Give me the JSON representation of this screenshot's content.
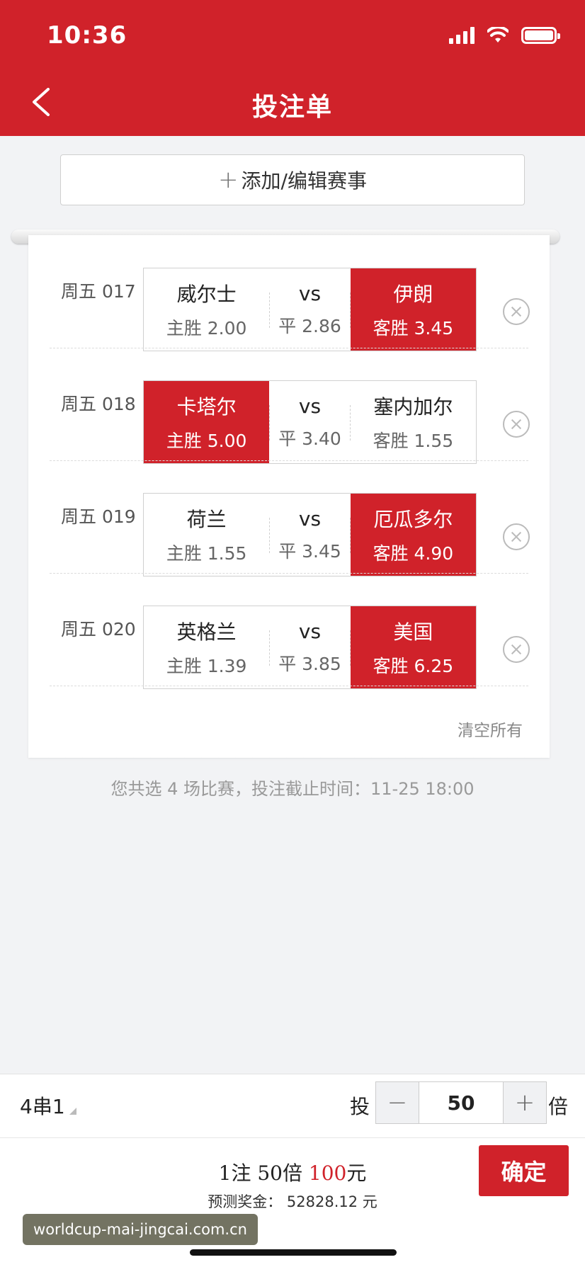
{
  "status": {
    "time": "10:36"
  },
  "header": {
    "title": "投注单",
    "back_icon": "chevron-left-icon"
  },
  "add_button": {
    "plus": "+",
    "label": "添加/编辑赛事"
  },
  "matches": [
    {
      "code": "周五 017",
      "home": "威尔士",
      "home_odds": "主胜 2.00",
      "vs": "vs",
      "draw_odds": "平 2.86",
      "away": "伊朗",
      "away_odds": "客胜 3.45",
      "selected": "away"
    },
    {
      "code": "周五 018",
      "home": "卡塔尔",
      "home_odds": "主胜 5.00",
      "vs": "vs",
      "draw_odds": "平 3.40",
      "away": "塞内加尔",
      "away_odds": "客胜 1.55",
      "selected": "home"
    },
    {
      "code": "周五 019",
      "home": "荷兰",
      "home_odds": "主胜 1.55",
      "vs": "vs",
      "draw_odds": "平 3.45",
      "away": "厄瓜多尔",
      "away_odds": "客胜 4.90",
      "selected": "away"
    },
    {
      "code": "周五 020",
      "home": "英格兰",
      "home_odds": "主胜 1.39",
      "vs": "vs",
      "draw_odds": "平 3.85",
      "away": "美国",
      "away_odds": "客胜 6.25",
      "selected": "away"
    }
  ],
  "clear_all": "清空所有",
  "summary": "您共选 4 场比赛，投注截止时间：11-25 18:00",
  "bet_bar": {
    "combo": "4串1",
    "tou": "投",
    "minus": "−",
    "multiplier": "50",
    "plus": "+",
    "bei": "倍"
  },
  "confirm": {
    "bet_prefix": "1注 50倍 ",
    "amount": "100",
    "unit": "元",
    "prize": "预测奖金：  52828.12 元",
    "button": "确定"
  },
  "watermark": "worldcup-mai-jingcai.com.cn",
  "colors": {
    "accent": "#d0222a",
    "background": "#f2f3f5"
  }
}
